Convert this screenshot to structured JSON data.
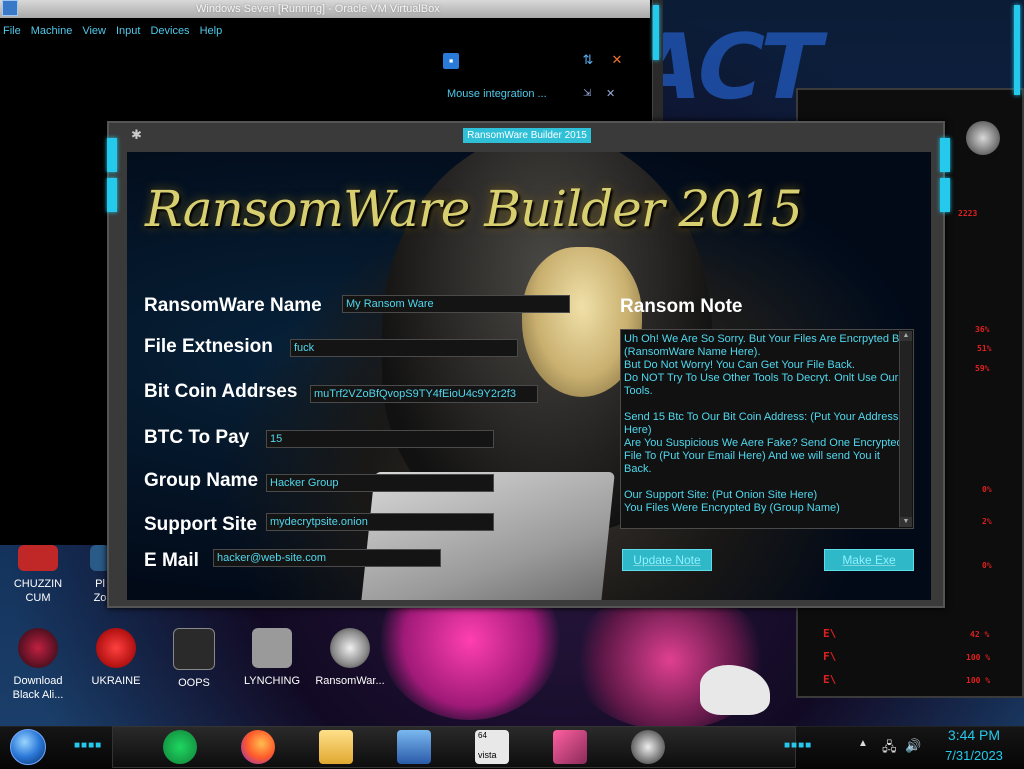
{
  "vm_window": {
    "title": "Windows Seven [Running] - Oracle VM VirtualBox",
    "menu": [
      "File",
      "Machine",
      "View",
      "Input",
      "Devices",
      "Help"
    ],
    "notification": "Mouse integration ..."
  },
  "ransomware_builder": {
    "window_title": "RansomWare Builder 2015",
    "logo_text": "RansomWare Builder 2015",
    "fields": {
      "ransomware_name": {
        "label": "RansomWare Name",
        "value": "My Ransom Ware"
      },
      "file_extension": {
        "label": "File Extnesion",
        "value": "fuck"
      },
      "bitcoin_address": {
        "label": "Bit Coin Addrses",
        "value": "muTrf2VZoBfQvopS9TY4fEioU4c9Y2r2f3"
      },
      "btc_to_pay": {
        "label": "BTC To Pay",
        "value": "15"
      },
      "group_name": {
        "label": "Group Name",
        "value": "Hacker Group"
      },
      "support_site": {
        "label": "Support Site",
        "value": "mydecrytpsite.onion"
      },
      "email": {
        "label": "E Mail",
        "value": "hacker@web-site.com"
      }
    },
    "ransom_note": {
      "label": "Ransom Note",
      "lines": [
        "Uh Oh! We Are So Sorry. But Your Files Are Encrpyted By",
        "(RansomWare Name Here).",
        "But Do Not Worry! You Can Get Your File Back.",
        "Do NOT Try To Use Other Tools To Decryt. Onlt Use Our",
        "Tools.",
        "",
        "Send 15 Btc To Our Bit Coin Address: (Put Your Address",
        "Here)",
        "Are You Suspicious We Aere Fake? Send One Encrypted",
        "File To (Put Your Email Here) And we will send You it",
        "Back.",
        "",
        "Our Support Site: (Put Onion Site Here)",
        "You Files Were Encrypted By (Group Name)"
      ]
    },
    "buttons": {
      "update_note": "Update Note",
      "make_exe": "Make Exe"
    }
  },
  "desktop_icons": [
    {
      "label": "CHUZZIN CUM",
      "line1": "CHUZZIN",
      "line2": "CUM"
    },
    {
      "label": "Pl Zo",
      "line1": "Pl",
      "line2": "Zo"
    },
    {
      "label": "Download Black Ali...",
      "line1": "Download",
      "line2": "Black Ali..."
    },
    {
      "label": "UKRAINE",
      "line1": "UKRAINE",
      "line2": ""
    },
    {
      "label": "OOPS",
      "line1": "OOPS",
      "line2": ""
    },
    {
      "label": "LYNCHING",
      "line1": "LYNCHING",
      "line2": ""
    },
    {
      "label": "RansomWar...",
      "line1": "RansomWar...",
      "line2": ""
    }
  ],
  "alienware_panel": {
    "stats": [
      "2223",
      "36%",
      "51%",
      "59%",
      "0%",
      "2%",
      "0%"
    ],
    "rows": [
      {
        "label": "E\\",
        "value": "42 %"
      },
      {
        "label": "F\\",
        "value": "100 %"
      },
      {
        "label": "E\\",
        "value": "100 %"
      }
    ]
  },
  "taskbar": {
    "apps": [
      "spotify-icon",
      "firefox-icon",
      "file-explorer-icon",
      "virtualbox-icon",
      "vista-64-icon",
      "media-icon",
      "ransomware-skull-icon"
    ],
    "vista_badge": "64",
    "vista_label": "vista",
    "time": "3:44 PM",
    "date": "7/31/2023"
  },
  "colors": {
    "accent_cyan": "#25c9ec",
    "alien_red": "#e02020",
    "logo_gold": "#d8d070"
  }
}
